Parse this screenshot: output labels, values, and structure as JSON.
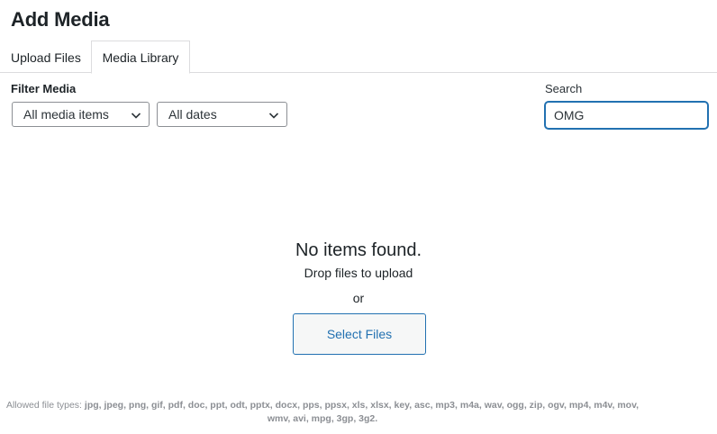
{
  "modal": {
    "title": "Add Media"
  },
  "tabs": [
    {
      "label": "Upload Files",
      "active": false
    },
    {
      "label": "Media Library",
      "active": true
    }
  ],
  "filters": {
    "label": "Filter Media",
    "type_select": {
      "value": "All media items",
      "icon": "chevron-down-icon"
    },
    "date_select": {
      "value": "All dates",
      "icon": "chevron-down-icon"
    }
  },
  "search": {
    "label": "Search",
    "value": "OMG"
  },
  "empty_state": {
    "title": "No items found.",
    "drop_text": "Drop files to upload",
    "or_text": "or",
    "button_label": "Select Files"
  },
  "footer": {
    "allowed_prefix": "Allowed file types: ",
    "allowed_types": "jpg, jpeg, png, gif, pdf, doc, ppt, odt, pptx, docx, pps, ppsx, xls, xlsx, key, asc, mp3, m4a, wav, ogg, zip, ogv, mp4, m4v, mov, wmv, avi, mpg, 3gp, 3g2."
  },
  "colors": {
    "accent": "#2271b1",
    "border": "#8c8f94",
    "text": "#1d2327",
    "muted": "#8c8f94"
  }
}
